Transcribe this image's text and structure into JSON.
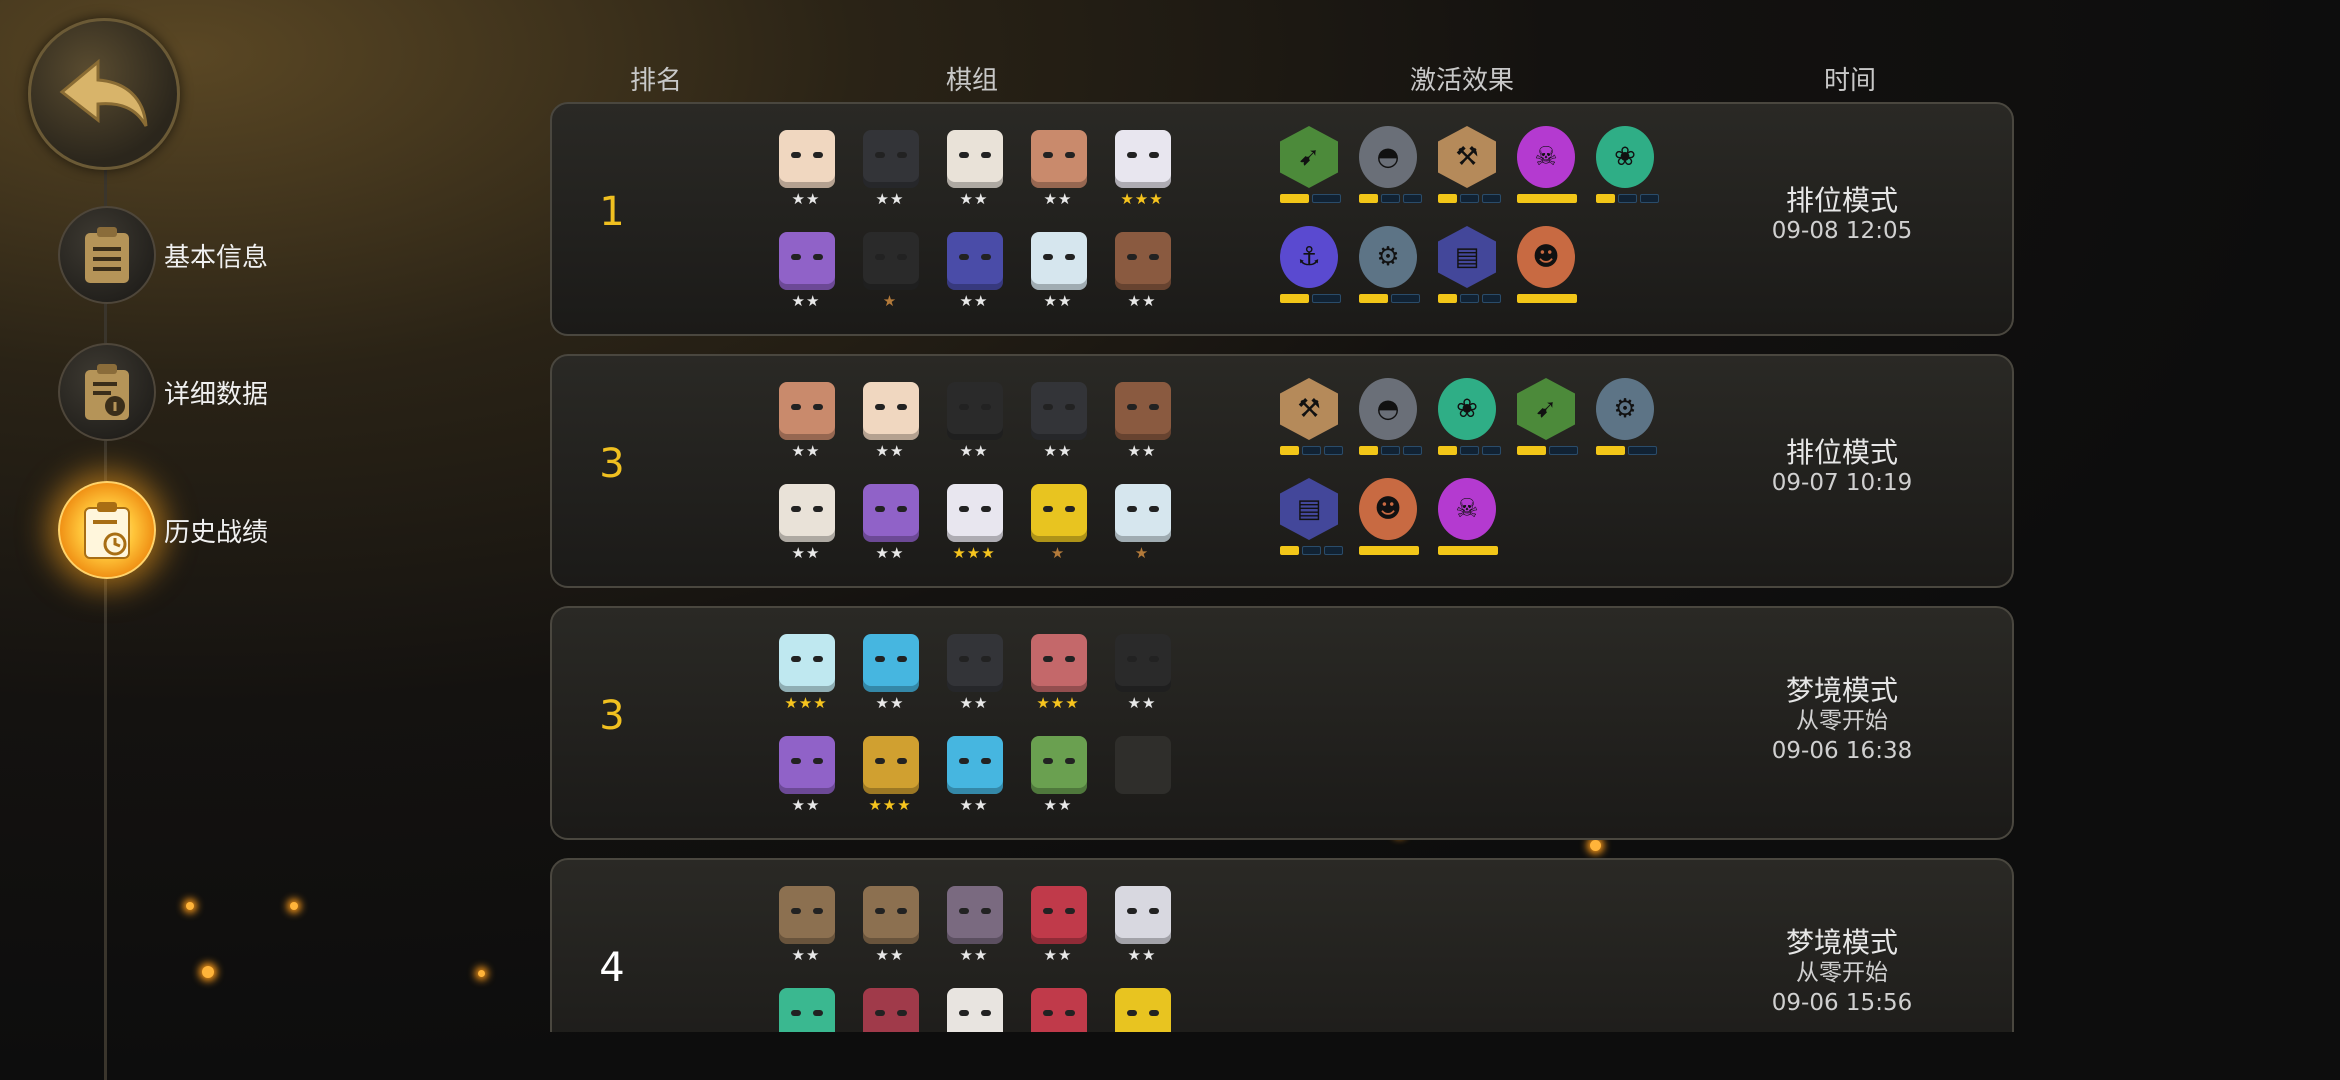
{
  "header": {
    "rank": "排名",
    "pieces": "棋组",
    "synergy": "激活效果",
    "time": "时间"
  },
  "sidebar": {
    "back": "返回",
    "items": [
      {
        "label": "基本信息"
      },
      {
        "label": "详细数据"
      },
      {
        "label": "历史战绩"
      }
    ]
  },
  "records": [
    {
      "rank": "1",
      "mode": "排位模式",
      "sub": "",
      "time": "09-08 12:05",
      "pieces": [
        {
          "stars": "★★",
          "tone": "white",
          "color": "#f0d7c0"
        },
        {
          "stars": "★★",
          "tone": "white",
          "color": "#333438"
        },
        {
          "stars": "★★",
          "tone": "white",
          "color": "#e9e2d8"
        },
        {
          "stars": "★★",
          "tone": "white",
          "color": "#c98a6c"
        },
        {
          "stars": "★★★",
          "tone": "gold",
          "color": "#e8e6ef"
        },
        {
          "stars": "★★",
          "tone": "white",
          "color": "#9062c8"
        },
        {
          "stars": "★",
          "tone": "bronze",
          "color": "#2a2a2a"
        },
        {
          "stars": "★★",
          "tone": "white",
          "color": "#4a4ca8"
        },
        {
          "stars": "★★",
          "tone": "white",
          "color": "#d6e6ee"
        },
        {
          "stars": "★★",
          "tone": "white",
          "color": "#8a5a40"
        }
      ],
      "synergies": [
        {
          "icon": "bow",
          "color": "#4c8a3a",
          "bars": [
            1,
            0
          ]
        },
        {
          "icon": "helm",
          "color": "#6a6f78",
          "round": true,
          "bars": [
            1,
            0,
            0
          ]
        },
        {
          "icon": "axe",
          "color": "#b58a5a",
          "bars": [
            1,
            0,
            0
          ]
        },
        {
          "icon": "demon",
          "color": "#b43ad0",
          "round": true,
          "bars": [
            1
          ]
        },
        {
          "icon": "paw",
          "color": "#2fae86",
          "round": true,
          "bars": [
            1,
            0,
            0
          ]
        },
        {
          "icon": "fish",
          "color": "#5a4ad0",
          "round": true,
          "bars": [
            1,
            0
          ]
        },
        {
          "icon": "scale",
          "color": "#5d7486",
          "round": true,
          "bars": [
            1,
            0
          ]
        },
        {
          "icon": "book",
          "color": "#43479a",
          "bars": [
            1,
            0,
            0
          ]
        },
        {
          "icon": "orc",
          "color": "#c86a42",
          "round": true,
          "bars": [
            1
          ]
        }
      ]
    },
    {
      "rank": "3",
      "mode": "排位模式",
      "sub": "",
      "time": "09-07 10:19",
      "pieces": [
        {
          "stars": "★★",
          "tone": "white",
          "color": "#c98a6c"
        },
        {
          "stars": "★★",
          "tone": "white",
          "color": "#f0d7c0"
        },
        {
          "stars": "★★",
          "tone": "white",
          "color": "#2a2a2a"
        },
        {
          "stars": "★★",
          "tone": "white",
          "color": "#333438"
        },
        {
          "stars": "★★",
          "tone": "white",
          "color": "#8a5a40"
        },
        {
          "stars": "★★",
          "tone": "white",
          "color": "#e9e2d8"
        },
        {
          "stars": "★★",
          "tone": "white",
          "color": "#9062c8"
        },
        {
          "stars": "★★★",
          "tone": "gold",
          "color": "#e8e6ef"
        },
        {
          "stars": "★",
          "tone": "bronze",
          "color": "#e8c420"
        },
        {
          "stars": "★",
          "tone": "bronze",
          "color": "#d6e6ee"
        }
      ],
      "synergies": [
        {
          "icon": "axe",
          "color": "#b58a5a",
          "bars": [
            1,
            0,
            0
          ]
        },
        {
          "icon": "helm",
          "color": "#6a6f78",
          "round": true,
          "bars": [
            1,
            0,
            0
          ]
        },
        {
          "icon": "paw",
          "color": "#2fae86",
          "round": true,
          "bars": [
            1,
            0,
            0
          ]
        },
        {
          "icon": "bow",
          "color": "#4c8a3a",
          "bars": [
            1,
            0
          ]
        },
        {
          "icon": "scale",
          "color": "#5d7486",
          "round": true,
          "bars": [
            1,
            0
          ]
        },
        {
          "icon": "book",
          "color": "#43479a",
          "bars": [
            1,
            0,
            0
          ]
        },
        {
          "icon": "orc",
          "color": "#c86a42",
          "round": true,
          "bars": [
            1
          ]
        },
        {
          "icon": "demon",
          "color": "#b43ad0",
          "round": true,
          "bars": [
            1
          ]
        }
      ]
    },
    {
      "rank": "3",
      "mode": "梦境模式",
      "sub": "从零开始",
      "time": "09-06 16:38",
      "pieces": [
        {
          "stars": "★★★",
          "tone": "gold",
          "color": "#bfe8f0"
        },
        {
          "stars": "★★",
          "tone": "white",
          "color": "#46b6e0"
        },
        {
          "stars": "★★",
          "tone": "white",
          "color": "#333438"
        },
        {
          "stars": "★★★",
          "tone": "gold",
          "color": "#c4686a"
        },
        {
          "stars": "★★",
          "tone": "white",
          "color": "#2a2a2a"
        },
        {
          "stars": "★★",
          "tone": "white",
          "color": "#9062c8"
        },
        {
          "stars": "★★★",
          "tone": "gold",
          "color": "#d0a030"
        },
        {
          "stars": "★★",
          "tone": "white",
          "color": "#46b6e0"
        },
        {
          "stars": "★★",
          "tone": "white",
          "color": "#6aa050"
        },
        {
          "stars": "",
          "tone": "white",
          "color": "",
          "empty": true
        }
      ],
      "synergies": []
    },
    {
      "rank": "4",
      "mode": "梦境模式",
      "sub": "从零开始",
      "time": "09-06 15:56",
      "pieces": [
        {
          "stars": "★★",
          "tone": "white",
          "color": "#8c7050"
        },
        {
          "stars": "★★",
          "tone": "white",
          "color": "#8c7050"
        },
        {
          "stars": "★★",
          "tone": "white",
          "color": "#7a6a80"
        },
        {
          "stars": "★★",
          "tone": "white",
          "color": "#c03a4a"
        },
        {
          "stars": "★★",
          "tone": "white",
          "color": "#d8d8e0"
        },
        {
          "stars": "★★",
          "tone": "white",
          "color": "#3ab890"
        },
        {
          "stars": "★★",
          "tone": "white",
          "color": "#a03a4a"
        },
        {
          "stars": "★★",
          "tone": "white",
          "color": "#e8e4e0"
        },
        {
          "stars": "★★",
          "tone": "white",
          "color": "#c03a4a"
        },
        {
          "stars": "★★",
          "tone": "white",
          "color": "#e8c420"
        }
      ],
      "synergies": []
    }
  ]
}
